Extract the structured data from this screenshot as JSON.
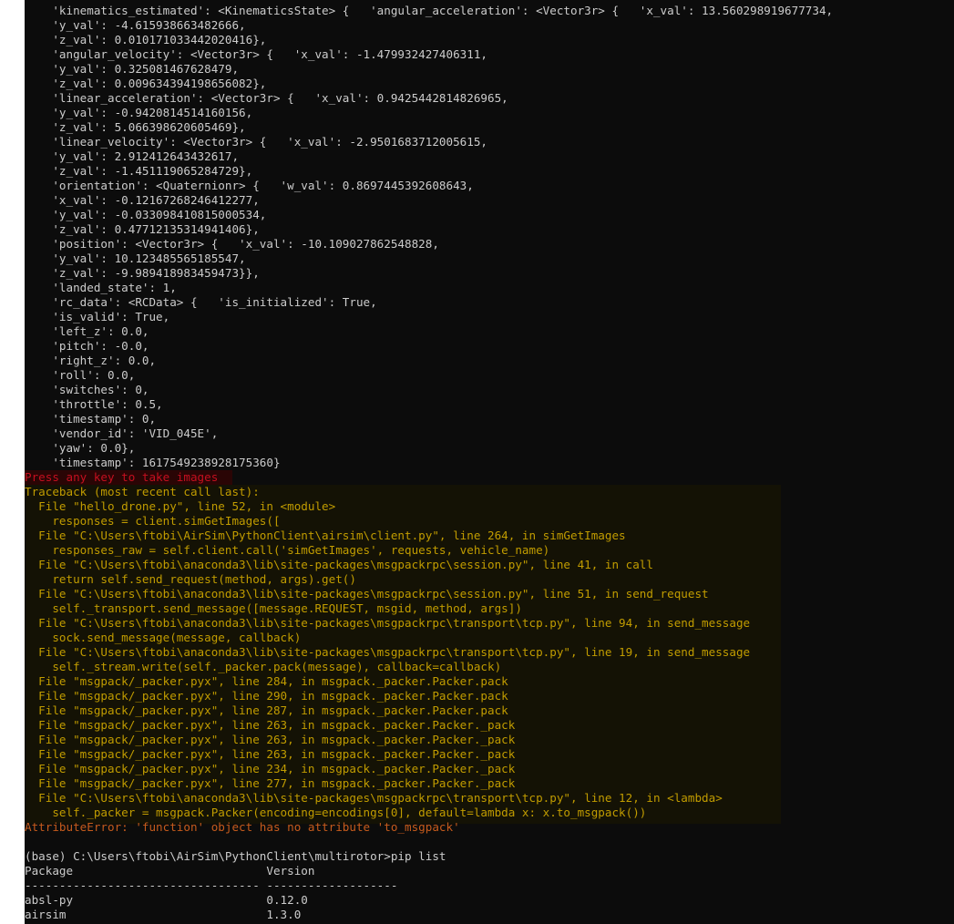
{
  "terminal": {
    "colors": {
      "background": "#0c0c0c",
      "text": "#cccccc",
      "error_red": "#c50f1f",
      "traceback_yellow": "#c19c00",
      "attribute_error": "#c65b1c"
    },
    "lines": [
      "    'kinematics_estimated': <KinematicsState> {   'angular_acceleration': <Vector3r> {   'x_val': 13.560298919677734,",
      "    'y_val': -4.615938663482666,",
      "    'z_val': 0.010171033442020416},",
      "    'angular_velocity': <Vector3r> {   'x_val': -1.479932427406311,",
      "    'y_val': 0.325081467628479,",
      "    'z_val': 0.009634394198656082},",
      "    'linear_acceleration': <Vector3r> {   'x_val': 0.9425442814826965,",
      "    'y_val': -0.9420814514160156,",
      "    'z_val': 5.066398620605469},",
      "    'linear_velocity': <Vector3r> {   'x_val': -2.9501683712005615,",
      "    'y_val': 2.912412643432617,",
      "    'z_val': -1.451119065284729},",
      "    'orientation': <Quaternionr> {   'w_val': 0.8697445392608643,",
      "    'x_val': -0.12167268246412277,",
      "    'y_val': -0.033098410815000534,",
      "    'z_val': 0.47712135314941406},",
      "    'position': <Vector3r> {   'x_val': -10.109027862548828,",
      "    'y_val': 10.123485565185547,",
      "    'z_val': -9.989418983459473}},",
      "    'landed_state': 1,",
      "    'rc_data': <RCData> {   'is_initialized': True,",
      "    'is_valid': True,",
      "    'left_z': 0.0,",
      "    'pitch': -0.0,",
      "    'right_z': 0.0,",
      "    'roll': 0.0,",
      "    'switches': 0,",
      "    'throttle': 0.5,",
      "    'timestamp': 0,",
      "    'vendor_id': 'VID_045E',",
      "    'yaw': 0.0},",
      "    'timestamp': 1617549238928175360}",
      "Press any key to take images",
      "Traceback (most recent call last):",
      "  File \"hello_drone.py\", line 52, in <module>",
      "    responses = client.simGetImages([",
      "  File \"C:\\Users\\ftobi\\AirSim\\PythonClient\\airsim\\client.py\", line 264, in simGetImages",
      "    responses_raw = self.client.call('simGetImages', requests, vehicle_name)",
      "  File \"C:\\Users\\ftobi\\anaconda3\\lib\\site-packages\\msgpackrpc\\session.py\", line 41, in call",
      "    return self.send_request(method, args).get()",
      "  File \"C:\\Users\\ftobi\\anaconda3\\lib\\site-packages\\msgpackrpc\\session.py\", line 51, in send_request",
      "    self._transport.send_message([message.REQUEST, msgid, method, args])",
      "  File \"C:\\Users\\ftobi\\anaconda3\\lib\\site-packages\\msgpackrpc\\transport\\tcp.py\", line 94, in send_message",
      "    sock.send_message(message, callback)",
      "  File \"C:\\Users\\ftobi\\anaconda3\\lib\\site-packages\\msgpackrpc\\transport\\tcp.py\", line 19, in send_message",
      "    self._stream.write(self._packer.pack(message), callback=callback)",
      "  File \"msgpack/_packer.pyx\", line 284, in msgpack._packer.Packer.pack",
      "  File \"msgpack/_packer.pyx\", line 290, in msgpack._packer.Packer.pack",
      "  File \"msgpack/_packer.pyx\", line 287, in msgpack._packer.Packer.pack",
      "  File \"msgpack/_packer.pyx\", line 263, in msgpack._packer.Packer._pack",
      "  File \"msgpack/_packer.pyx\", line 263, in msgpack._packer.Packer._pack",
      "  File \"msgpack/_packer.pyx\", line 263, in msgpack._packer.Packer._pack",
      "  File \"msgpack/_packer.pyx\", line 234, in msgpack._packer.Packer._pack",
      "  File \"msgpack/_packer.pyx\", line 277, in msgpack._packer.Packer._pack",
      "  File \"C:\\Users\\ftobi\\anaconda3\\lib\\site-packages\\msgpackrpc\\transport\\tcp.py\", line 12, in <lambda>",
      "    self._packer = msgpack.Packer(encoding=encodings[0], default=lambda x: x.to_msgpack())",
      "AttributeError: 'function' object has no attribute 'to_msgpack'",
      "",
      "(base) C:\\Users\\ftobi\\AirSim\\PythonClient\\multirotor>pip list",
      "Package                            Version",
      "---------------------------------- -------------------",
      "absl-py                            0.12.0",
      "airsim                             1.3.0"
    ]
  }
}
